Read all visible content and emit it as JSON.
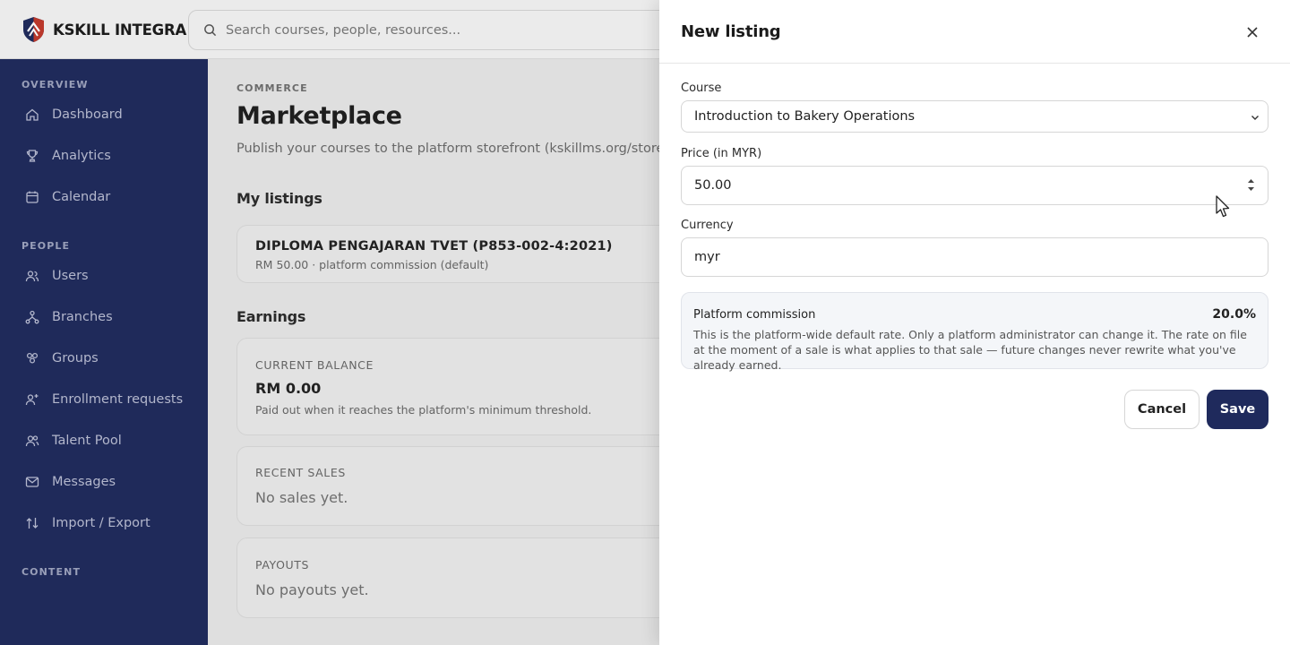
{
  "brand": {
    "name": "KSKILL INTEGRA"
  },
  "search": {
    "placeholder": "Search courses, people, resources..."
  },
  "sidebar": {
    "sections": [
      {
        "label": "OVERVIEW"
      },
      {
        "label": "PEOPLE"
      },
      {
        "label": "CONTENT"
      }
    ],
    "items": [
      {
        "label": "Dashboard",
        "icon": "home-icon"
      },
      {
        "label": "Analytics",
        "icon": "trophy-icon"
      },
      {
        "label": "Calendar",
        "icon": "calendar-icon"
      },
      {
        "label": "Users",
        "icon": "users-icon"
      },
      {
        "label": "Branches",
        "icon": "branches-icon"
      },
      {
        "label": "Groups",
        "icon": "groups-icon"
      },
      {
        "label": "Enrollment requests",
        "icon": "user-plus-icon"
      },
      {
        "label": "Talent Pool",
        "icon": "talent-icon"
      },
      {
        "label": "Messages",
        "icon": "mail-icon"
      },
      {
        "label": "Import / Export",
        "icon": "import-export-icon"
      }
    ]
  },
  "main": {
    "eyebrow": "COMMERCE",
    "title": "Marketplace",
    "description": "Publish your courses to the platform storefront (kskillms.org/store). T",
    "listings_heading": "My listings",
    "listing": {
      "title": "DIPLOMA PENGAJARAN TVET (P853-002-4:2021)",
      "subtitle": "RM 50.00 · platform commission (default)"
    },
    "earnings_heading": "Earnings",
    "balance": {
      "label": "CURRENT BALANCE",
      "amount": "RM 0.00",
      "note": "Paid out when it reaches the platform's minimum threshold."
    },
    "recent_sales": {
      "label": "RECENT SALES",
      "empty": "No sales yet."
    },
    "payouts": {
      "label": "PAYOUTS",
      "empty": "No payouts yet."
    }
  },
  "drawer": {
    "title": "New listing",
    "course_label": "Course",
    "course_value": "Introduction to Bakery Operations",
    "price_label": "Price (in MYR)",
    "price_value": "50.00",
    "currency_label": "Currency",
    "currency_value": "myr",
    "commission": {
      "title": "Platform commission",
      "rate": "20.0%",
      "text": "This is the platform-wide default rate. Only a platform administrator can change it. The rate on file at the moment of a sale is what applies to that sale — future changes never rewrite what you've already earned."
    },
    "cancel_label": "Cancel",
    "save_label": "Save"
  },
  "colors": {
    "brand_navy": "#1f2a5c",
    "sidebar_text": "#b9bdd3"
  }
}
